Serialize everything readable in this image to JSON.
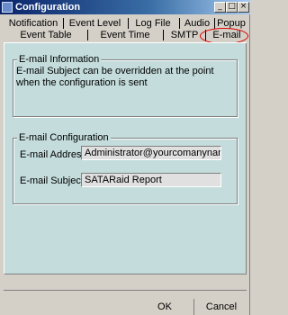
{
  "window": {
    "title": "Configuration",
    "minimize_glyph": "_",
    "maximize_glyph": "□",
    "close_glyph": "×"
  },
  "tabs": {
    "row1": [
      "Notification",
      "Event Level",
      "Log File",
      "Audio",
      "Popup"
    ],
    "row2": [
      "Event Table",
      "Event Time",
      "SMTP",
      "E-mail"
    ],
    "selected": "E-mail"
  },
  "info_group": {
    "title": "E-mail Information",
    "text": "E-mail Subject can be overridden at the point when the configuration is sent"
  },
  "config_group": {
    "title": "E-mail Configuration",
    "address_label": "E-mail Address:",
    "address_value": "Administrator@yourcomanyname.com",
    "subject_label": "E-mail Subject:",
    "subject_value": "SATARaid Report"
  },
  "buttons": {
    "ok": "OK",
    "cancel": "Cancel"
  },
  "colors": {
    "panel": "#c4dcdc",
    "window": "#d4d0c8",
    "titlebar": "#0a246a",
    "highlight": "#e00000"
  }
}
